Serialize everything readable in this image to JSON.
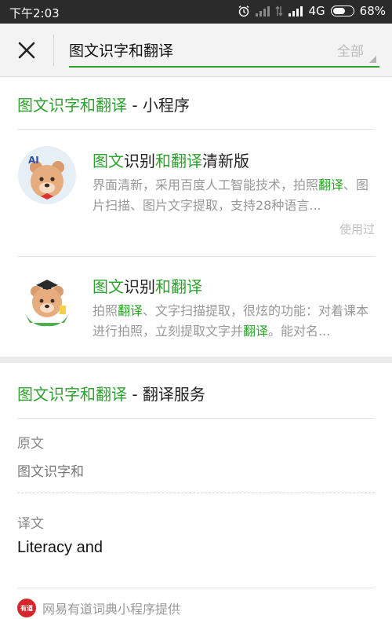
{
  "status_bar": {
    "time": "下午2:03",
    "network": "4G",
    "battery": "68%",
    "battery_level": 0.68
  },
  "search": {
    "query": "图文识字和翻译",
    "scope": "全部"
  },
  "miniprogram_section": {
    "title_highlight": "图文识字和翻译",
    "title_suffix": " - 小程序",
    "items": [
      {
        "title_parts": [
          "图文",
          "识别",
          "和翻译",
          "清新版"
        ],
        "desc_parts": [
          "界面清新，采用百度人工智能技术，拍照",
          "翻译",
          "、图片扫描、图片文字提取，支持28种语言..."
        ],
        "used_label": "使用过",
        "avatar_text": "AI",
        "icon": "bear-ai-avatar-icon"
      },
      {
        "title_parts": [
          "图文",
          "识别",
          "和翻译"
        ],
        "desc_parts": [
          "拍照",
          "翻译",
          "、文字扫描提取，很炫的功能：对着课本进行拍照，立刻提取文字并",
          "翻译",
          "。能对名..."
        ],
        "icon": "bear-graduate-avatar-icon"
      }
    ]
  },
  "translate_section": {
    "title_highlight": "图文识字和翻译",
    "title_suffix": " - 翻译服务",
    "source_label": "原文",
    "source_text": "图文识字和",
    "target_label": "译文",
    "target_text": "Literacy and",
    "provider_text": "网易有道词典小程序提供",
    "provider_icon_text": "有道"
  },
  "colors": {
    "accent": "#2da32d",
    "status_bar": "#2b2b2b",
    "provider": "#d6262b"
  }
}
